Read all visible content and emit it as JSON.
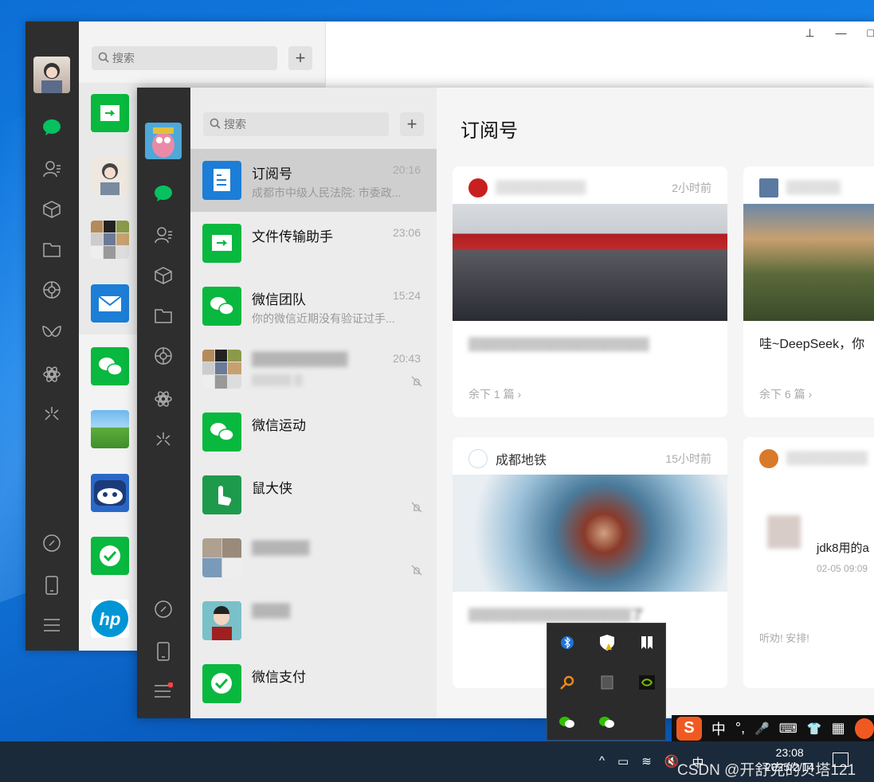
{
  "back_window": {
    "search_placeholder": "搜索",
    "plus": "+",
    "title_buttons": [
      "⊥",
      "—",
      "□"
    ]
  },
  "front_window": {
    "search_placeholder": "搜索",
    "plus": "+",
    "chats": [
      {
        "name": "订阅号",
        "time": "20:16",
        "snippet": "成都市中级人民法院: 市委政...",
        "muted": false,
        "selected": true
      },
      {
        "name": "文件传输助手",
        "time": "23:06",
        "snippet": "",
        "muted": false
      },
      {
        "name": "微信团队",
        "time": "15:24",
        "snippet": "你的微信近期没有验证过手...",
        "muted": false
      },
      {
        "name": "▒▒▒▒▒▒▒▒▒▒",
        "time": "20:43",
        "snippet": "▒▒▒▒▒ ▒",
        "muted": true
      },
      {
        "name": "微信运动",
        "time": "",
        "snippet": "",
        "muted": false
      },
      {
        "name": "鼠大侠",
        "time": "",
        "snippet": "",
        "muted": true
      },
      {
        "name": "▒▒▒▒▒▒",
        "time": "",
        "snippet": "",
        "muted": true
      },
      {
        "name": "▒▒▒▒",
        "time": "",
        "snippet": "",
        "muted": false
      },
      {
        "name": "微信支付",
        "time": "",
        "snippet": "",
        "muted": false
      }
    ],
    "content_title": "订阅号",
    "cards": [
      {
        "source": "▒▒▒▒▒▒▒▒▒▒",
        "time": "2小时前",
        "title": "▒▒▒▒▒▒▒▒▒▒▒▒▒▒▒▒▒▒▒▒",
        "more": "余下 1 篇 ›"
      },
      {
        "source": "▒▒▒▒▒▒",
        "time": "",
        "title": "哇~DeepSeek，你",
        "more": "余下 6 篇 ›"
      },
      {
        "source": "成都地铁",
        "time": "15小时前",
        "title": "▒▒▒▒▒▒▒▒▒▒▒▒▒▒▒▒▒▒了",
        "more": ""
      },
      {
        "source": "▒▒▒▒▒▒▒▒▒",
        "time": "",
        "title": "jdk8用的a",
        "date": "02-05 09:09",
        "sub": "听劝! 安排!"
      }
    ]
  },
  "ime_bar": {
    "items": [
      "中",
      "°,",
      "🎤",
      "⌨",
      "👕",
      "▦"
    ]
  },
  "taskbar": {
    "time": "23:08",
    "date": "2025/2/14",
    "tray_chars": [
      "^",
      "▭",
      "≋",
      "🔇",
      "中"
    ]
  },
  "watermark": "CSDN @开舒克的贝塔121",
  "colors": {
    "wechat_green": "#09b83e",
    "rail": "#2e2e2e",
    "desktop": "#0d6fd6"
  }
}
